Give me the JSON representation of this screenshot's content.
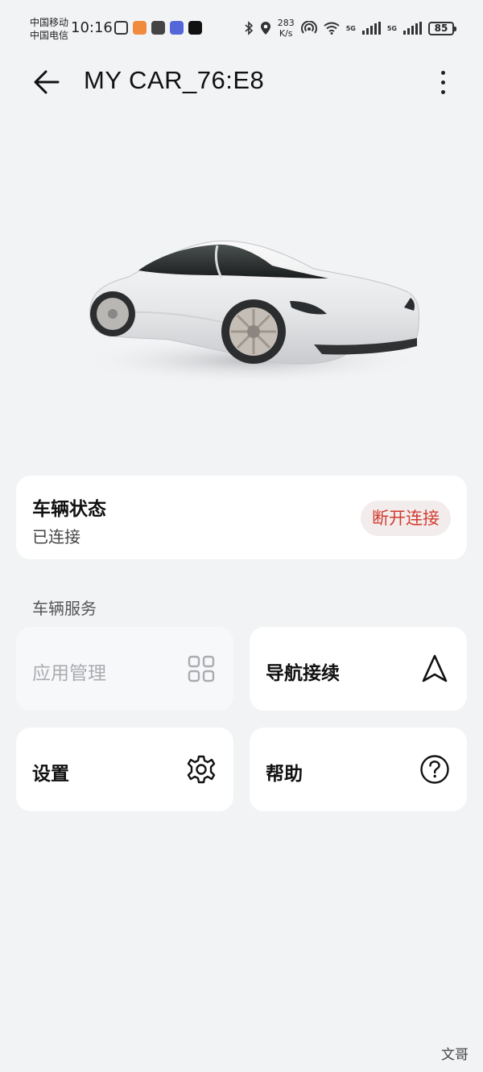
{
  "status_bar": {
    "carrier_1": "中国移动",
    "carrier_2": "中国电信",
    "time": "10:16",
    "net_speed_value": "283",
    "net_speed_unit": "K/s",
    "signal_1_label": "5G",
    "signal_2_label": "5G",
    "battery": "85",
    "notification_icons": [
      "nfc-icon",
      "health-icon",
      "car-icon",
      "app-icon",
      "tiktok-icon"
    ],
    "system_icons": [
      "bluetooth-icon",
      "location-icon",
      "hotspot-icon",
      "wifi-icon",
      "cell-signal-icon",
      "cell-signal-icon",
      "battery-icon"
    ]
  },
  "header": {
    "title": "MY CAR_76:E8",
    "back_icon": "arrow-left-icon",
    "more_icon": "more-vertical-icon"
  },
  "vehicle_status": {
    "title": "车辆状态",
    "value": "已连接",
    "disconnect_label": "断开连接",
    "disconnect_color": "#d23c2f"
  },
  "services": {
    "section_label": "车辆服务",
    "tiles": [
      {
        "label": "应用管理",
        "icon": "grid-icon",
        "enabled": false
      },
      {
        "label": "导航接续",
        "icon": "navigation-icon",
        "enabled": true
      },
      {
        "label": "设置",
        "icon": "gear-icon",
        "enabled": true
      },
      {
        "label": "帮助",
        "icon": "help-icon",
        "enabled": true
      }
    ]
  },
  "watermark": "文哥",
  "colors": {
    "background": "#f1f3f5",
    "card": "#ffffff",
    "accent_red": "#d23c2f"
  }
}
